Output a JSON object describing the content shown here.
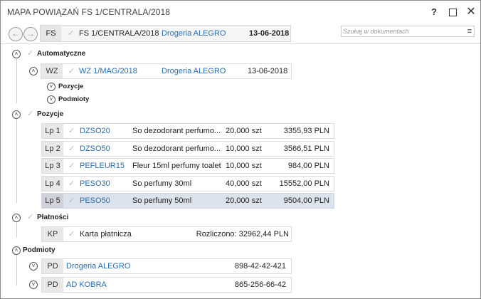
{
  "window": {
    "title": "MAPA POWIĄZAŃ FS 1/CENTRALA/2018",
    "help": "?",
    "close": "✕"
  },
  "toolbar": {
    "back": "←",
    "forward": "→",
    "doc_type": "FS",
    "doc_number": "FS 1/CENTRALA/2018",
    "contractor": "Drogeria ALEGRO",
    "date": "13-06-2018",
    "search_placeholder": "Szukaj w dokumentach",
    "search_value": "",
    "menu": "≡"
  },
  "sections": {
    "automatyczne": {
      "label": "Automatyczne",
      "toggle": "˄",
      "doc": {
        "type": "WZ",
        "number": "WZ 1/MAG/2018",
        "contractor": "Drogeria ALEGRO",
        "date": "13-06-2018",
        "toggle": "˄"
      },
      "sub_items": [
        {
          "label": "Pozycje",
          "toggle": "˅"
        },
        {
          "label": "Podmioty",
          "toggle": "˅"
        }
      ]
    },
    "pozycje": {
      "label": "Pozycje",
      "toggle": "˄",
      "rows": [
        {
          "lp": "Lp 1",
          "code": "DZSO20",
          "name": "So dezodorant perfumo...",
          "qty": "20,000 szt",
          "value": "3355,93 PLN",
          "selected": false
        },
        {
          "lp": "Lp 2",
          "code": "DZSO50",
          "name": "So dezodorant perfumo...",
          "qty": "10,000 szt",
          "value": "3566,51 PLN",
          "selected": false
        },
        {
          "lp": "Lp 3",
          "code": "PEFLEUR15",
          "name": "Fleur 15ml perfumy toalet.",
          "qty": "10,000 szt",
          "value": "984,00 PLN",
          "selected": false
        },
        {
          "lp": "Lp 4",
          "code": "PESO30",
          "name": "So perfumy 30ml",
          "qty": "40,000 szt",
          "value": "15552,00 PLN",
          "selected": false
        },
        {
          "lp": "Lp 5",
          "code": "PESO50",
          "name": "So perfumy 50ml",
          "qty": "20,000 szt",
          "value": "9504,00 PLN",
          "selected": true
        }
      ]
    },
    "platnosci": {
      "label": "Płatności",
      "toggle": "˄",
      "row": {
        "type": "KP",
        "name": "Karta płatnicza",
        "status": "Rozliczono: 32962,44 PLN"
      }
    },
    "podmioty": {
      "label": "Podmioty",
      "toggle": "˄",
      "rows": [
        {
          "type": "PD",
          "name": "Drogeria ALEGRO",
          "nip": "898-42-42-421",
          "toggle": "˅"
        },
        {
          "type": "PD",
          "name": "AD KOBRA",
          "nip": "865-256-66-42",
          "toggle": "˅"
        }
      ]
    }
  },
  "icons": {
    "check": "check-icon",
    "expand": "chevron-down-icon",
    "collapse": "chevron-up-icon"
  },
  "colors": {
    "link": "#2a6db0",
    "selected_row": "#dde3ec",
    "type_cell": "#e8e8e8"
  }
}
